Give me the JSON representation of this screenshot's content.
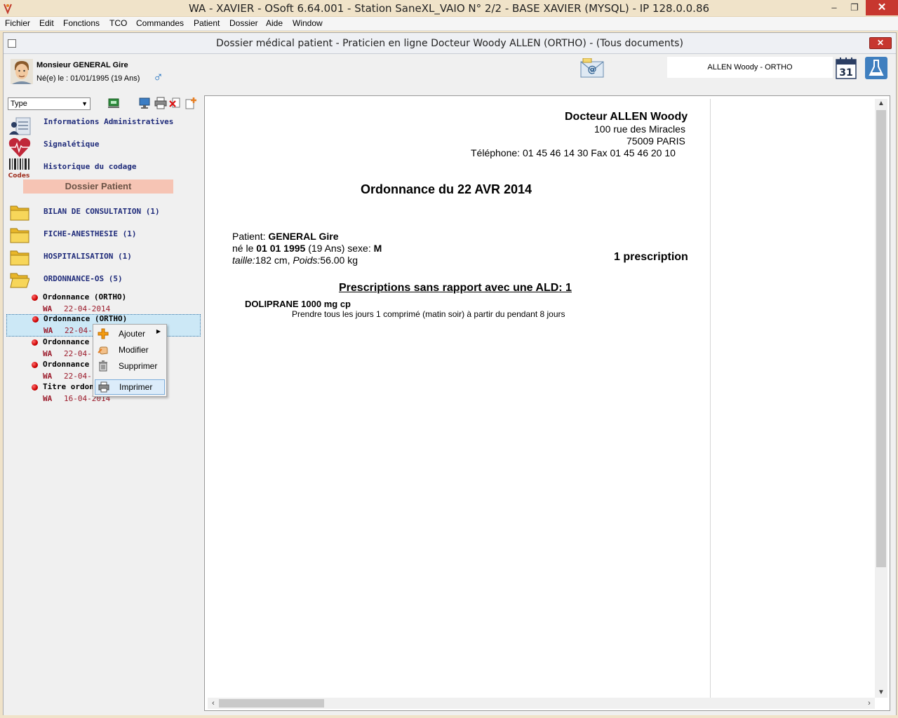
{
  "app": {
    "title": "WA - XAVIER - OSoft 6.64.001 - Station SaneXL_VAIO N° 2/2 - BASE XAVIER (MYSQL) - IP 128.0.0.86",
    "window_controls": {
      "minimize": "–",
      "maximize": "❐",
      "close": "✕"
    }
  },
  "menu": [
    "Fichier",
    "Edit",
    "Fonctions",
    "TCO",
    "Commandes",
    "Patient",
    "Dossier",
    "Aide",
    "Window"
  ],
  "inner_window": {
    "title": "Dossier médical patient - Praticien en ligne Docteur Woody ALLEN (ORTHO) - (Tous documents)",
    "close": "✕"
  },
  "patient": {
    "name": "Monsieur GENERAL Gire",
    "dob": "Né(e) le : 01/01/1995 (19 Ans)",
    "sex_symbol": "♂"
  },
  "practitioner": "ALLEN Woody - ORTHO",
  "icons": {
    "mail": "mail-icon",
    "calendar": "calendar-icon",
    "calendar_day": "31",
    "lab": "flask-icon"
  },
  "sidebar": {
    "type_select": "Type",
    "nav": [
      {
        "label": "Informations Administratives",
        "icon": "admin-info-icon"
      },
      {
        "label": "Signalétique",
        "icon": "heart-icon"
      },
      {
        "label": "Historique du codage",
        "icon": "codes-icon",
        "icon_caption": "Codes"
      }
    ],
    "section_title": "Dossier Patient",
    "folders": [
      {
        "label": "BILAN DE CONSULTATION (1)"
      },
      {
        "label": "FICHE-ANESTHESIE (1)"
      },
      {
        "label": "HOSPITALISATION (1)"
      },
      {
        "label": "ORDONNANCE-OS (5)"
      }
    ],
    "documents": [
      {
        "title": "Ordonnance (ORTHO)",
        "author": "WA",
        "date": "22-04-2014"
      },
      {
        "title": "Ordonnance (ORTHO)",
        "author": "WA",
        "date": "22-04-"
      },
      {
        "title": "Ordonnance",
        "author": "WA",
        "date": "22-04-"
      },
      {
        "title": "Ordonnance",
        "author": "WA",
        "date": "22-04-"
      },
      {
        "title": "Titre ordonn",
        "author": "WA",
        "date": "16-04-2014"
      }
    ]
  },
  "context_menu": {
    "items": [
      {
        "label": "Ajouter",
        "icon": "plus-icon",
        "has_submenu": true
      },
      {
        "label": "Modifier",
        "icon": "hand-edit-icon"
      },
      {
        "label": "Supprimer",
        "icon": "trash-icon"
      },
      {
        "label": "Imprimer",
        "icon": "printer-icon",
        "hovered": true
      }
    ]
  },
  "document": {
    "doctor_name": "Docteur ALLEN Woody",
    "address1": "100 rue des Miracles",
    "address2": "75009 PARIS",
    "phone_line": "Téléphone: 01 45 46 14 30  Fax 01 45 46 20 10",
    "heading": "Ordonnance du 22 AVR 2014",
    "patient_label": "Patient: ",
    "patient_name": "GENERAL Gire",
    "born_label": "né le ",
    "born_date": "01 01 1995",
    "age": " (19 Ans) sexe: ",
    "sex": "M",
    "taille_label": "taille:",
    "taille_value": "182 cm, ",
    "poids_label": "Poids:",
    "poids_value": "56.00 kg",
    "prescription_count": "1 prescription",
    "section": "Prescriptions sans rapport avec une ALD: 1",
    "drug": "DOLIPRANE 1000 mg cp",
    "instructions": "Prendre  tous les jours 1 comprimé (matin soir) à partir du  pendant 8 jours"
  },
  "colors": {
    "outer_chrome": "#f0e3c9",
    "close_red": "#c7372f",
    "nav_text": "#1f2b7a",
    "doc_date": "#9b1a2a",
    "section_banner": "#f6c4b4",
    "selection": "#cce8f6"
  }
}
